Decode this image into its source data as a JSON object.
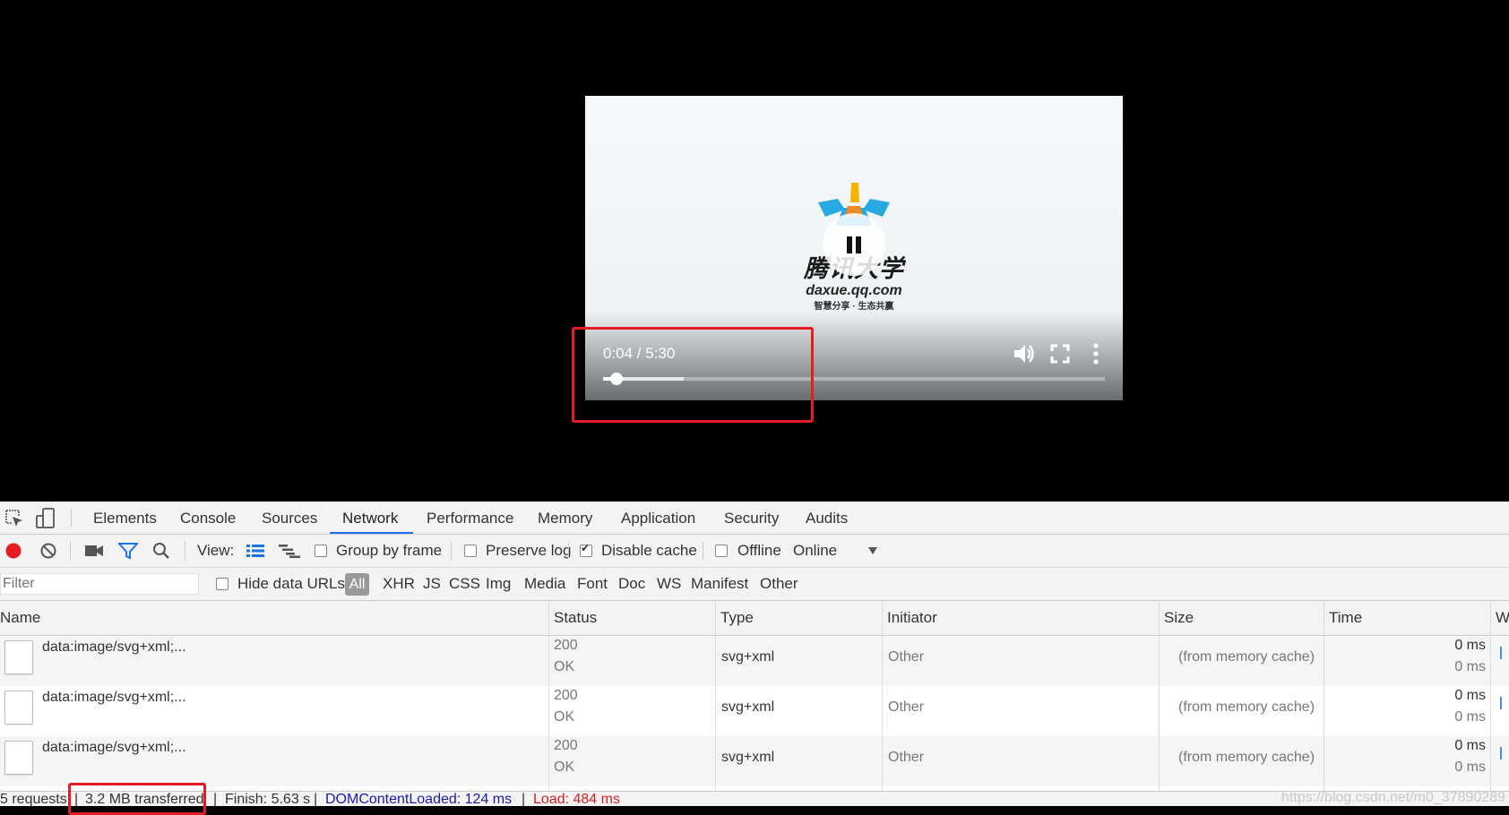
{
  "video": {
    "time_display": "0:04 / 5:30",
    "played_fraction": 0.026,
    "buffered_fraction": 0.16,
    "logo_text": "腾讯大学",
    "logo_domain": "daxue.qq.com",
    "logo_slogan": "智慧分享 · 生态共赢",
    "state": "playing"
  },
  "devtools": {
    "tabs": [
      "Elements",
      "Console",
      "Sources",
      "Network",
      "Performance",
      "Memory",
      "Application",
      "Security",
      "Audits"
    ],
    "active_tab": "Network",
    "toolbar": {
      "view_label": "View:",
      "group_by_frame": "Group by frame",
      "group_by_frame_checked": false,
      "preserve_log": "Preserve log",
      "preserve_log_checked": false,
      "disable_cache": "Disable cache",
      "disable_cache_checked": true,
      "offline": "Offline",
      "offline_checked": false,
      "throttle": "Online"
    },
    "filterbar": {
      "filter_placeholder": "Filter",
      "hide_data_urls": "Hide data URLs",
      "hide_data_urls_checked": false,
      "types": [
        "All",
        "XHR",
        "JS",
        "CSS",
        "Img",
        "Media",
        "Font",
        "Doc",
        "WS",
        "Manifest",
        "Other"
      ],
      "active_type": "All"
    },
    "columns": [
      "Name",
      "Status",
      "Type",
      "Initiator",
      "Size",
      "Time",
      "W"
    ],
    "rows": [
      {
        "name": "data:image/svg+xml;...",
        "status": "200",
        "status_text": "OK",
        "type": "svg+xml",
        "initiator": "Other",
        "size": "(from memory cache)",
        "time": "0 ms",
        "latency": "0 ms"
      },
      {
        "name": "data:image/svg+xml;...",
        "status": "200",
        "status_text": "OK",
        "type": "svg+xml",
        "initiator": "Other",
        "size": "(from memory cache)",
        "time": "0 ms",
        "latency": "0 ms"
      },
      {
        "name": "data:image/svg+xml;...",
        "status": "200",
        "status_text": "OK",
        "type": "svg+xml",
        "initiator": "Other",
        "size": "(from memory cache)",
        "time": "0 ms",
        "latency": "0 ms"
      }
    ],
    "status_bar": {
      "requests": "5 requests",
      "transferred": "3.2 MB transferred",
      "finish": "Finish: 5.63 s",
      "dom_content_loaded": "DOMContentLoaded: 124 ms",
      "load": "Load: 484 ms",
      "separator": "|"
    },
    "watermark": "https://blog.csdn.net/m0_37890289"
  },
  "colors": {
    "highlight": "#e51c23",
    "accent": "#1a73e8",
    "dcl": "#1a1aa8",
    "load": "#d71e1e"
  }
}
